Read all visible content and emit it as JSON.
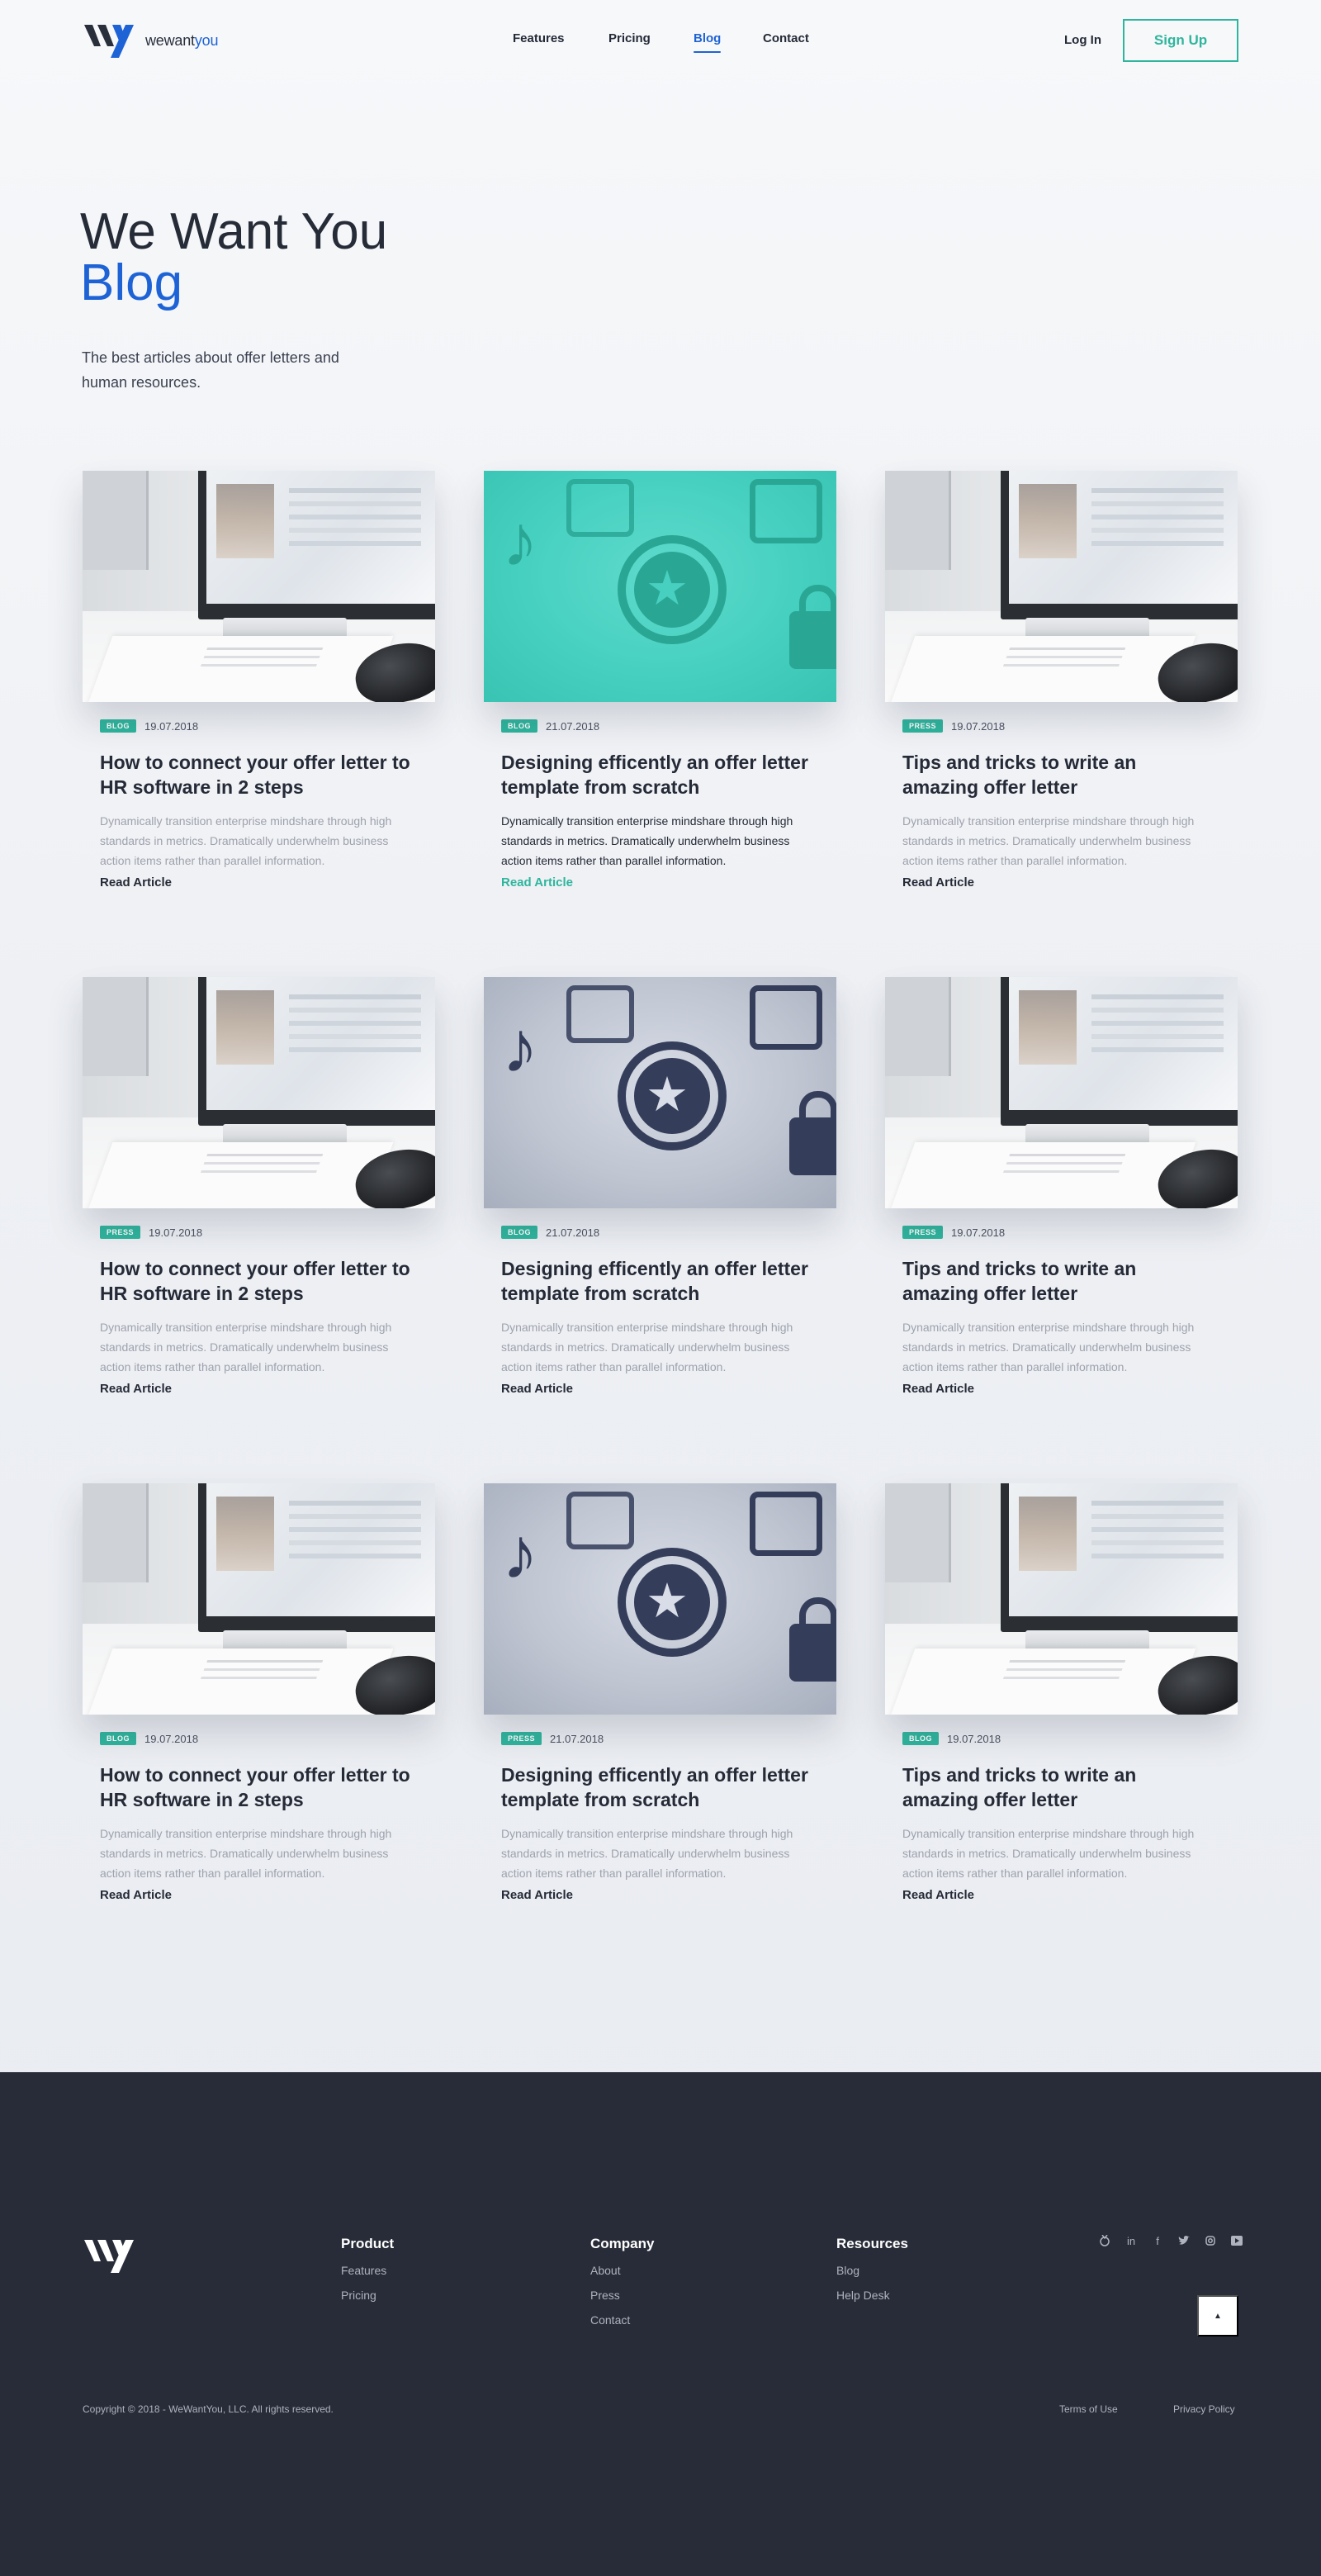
{
  "brand": {
    "name_part1": "wewant",
    "name_part2": "you",
    "accent_color": "#1e63d6",
    "green_color": "#2fb59d"
  },
  "nav": {
    "items": [
      {
        "label": "Features"
      },
      {
        "label": "Pricing"
      },
      {
        "label": "Blog",
        "active": true
      },
      {
        "label": "Contact"
      }
    ],
    "login_label": "Log In",
    "signup_label": "Sign Up"
  },
  "hero": {
    "title_line1": "We Want You",
    "title_line2": "Blog",
    "subtitle": "The best articles about offer letters and human resources."
  },
  "posts": [
    {
      "image": "desk-photo",
      "badge": "BLOG",
      "date": "19.07.2018",
      "title": "How to connect your offer letter to HR software in 2 steps",
      "excerpt": "Dynamically transition enterprise mindshare through high standards in metrics. Dramatically underwhelm business action items rather than parallel information.",
      "link": "Read Article"
    },
    {
      "image": "icons-photo-teal",
      "badge": "BLOG",
      "date": "21.07.2018",
      "title": "Designing efficently an offer letter template from scratch",
      "excerpt": "Dynamically transition enterprise mindshare through high standards in metrics. Dramatically underwhelm business action items rather than parallel information.",
      "link": "Read Article",
      "highlighted": true
    },
    {
      "image": "desk-photo",
      "badge": "PRESS",
      "date": "19.07.2018",
      "title": "Tips and tricks to write an amazing offer letter",
      "excerpt": "Dynamically transition enterprise mindshare through high standards in metrics. Dramatically underwhelm business action items rather than parallel information.",
      "link": "Read Article"
    },
    {
      "image": "desk-photo",
      "badge": "PRESS",
      "date": "19.07.2018",
      "title": "How to connect your offer letter to HR software in 2 steps",
      "excerpt": "Dynamically transition enterprise mindshare through high standards in metrics. Dramatically underwhelm business action items rather than parallel information.",
      "link": "Read Article"
    },
    {
      "image": "icons-photo-grey",
      "badge": "BLOG",
      "date": "21.07.2018",
      "title": "Designing efficently an offer letter template from scratch",
      "excerpt": "Dynamically transition enterprise mindshare through high standards in metrics. Dramatically underwhelm business action items rather than parallel information.",
      "link": "Read Article"
    },
    {
      "image": "desk-photo",
      "badge": "PRESS",
      "date": "19.07.2018",
      "title": "Tips and tricks to write an amazing offer letter",
      "excerpt": "Dynamically transition enterprise mindshare through high standards in metrics. Dramatically underwhelm business action items rather than parallel information.",
      "link": "Read Article"
    },
    {
      "image": "desk-photo",
      "badge": "BLOG",
      "date": "19.07.2018",
      "title": "How to connect your offer letter to HR software in 2 steps",
      "excerpt": "Dynamically transition enterprise mindshare through high standards in metrics. Dramatically underwhelm business action items rather than parallel information.",
      "link": "Read Article"
    },
    {
      "image": "icons-photo-grey",
      "badge": "PRESS",
      "date": "21.07.2018",
      "title": "Designing efficently an offer letter template from scratch",
      "excerpt": "Dynamically transition enterprise mindshare through high standards in metrics. Dramatically underwhelm business action items rather than parallel information.",
      "link": "Read Article"
    },
    {
      "image": "desk-photo",
      "badge": "BLOG",
      "date": "19.07.2018",
      "title": "Tips and tricks to write an amazing offer letter",
      "excerpt": "Dynamically transition enterprise mindshare through high standards in metrics. Dramatically underwhelm business action items rather than parallel information.",
      "link": "Read Article"
    }
  ],
  "footer": {
    "columns": [
      {
        "heading": "Product",
        "links": [
          "Features",
          "Pricing"
        ]
      },
      {
        "heading": "Company",
        "links": [
          "About",
          "Press",
          "Contact"
        ]
      },
      {
        "heading": "Resources",
        "links": [
          "Blog",
          "Help Desk"
        ]
      }
    ],
    "socials": [
      "product-hunt-icon",
      "linkedin-icon",
      "facebook-icon",
      "twitter-icon",
      "instagram-icon",
      "youtube-icon"
    ],
    "back_to_top_icon": "arrow-up-icon",
    "copyright": "Copyright © 2018 - WeWantYou, LLC. All rights reserved.",
    "terms_label": "Terms of Use",
    "privacy_label": "Privacy Policy"
  }
}
